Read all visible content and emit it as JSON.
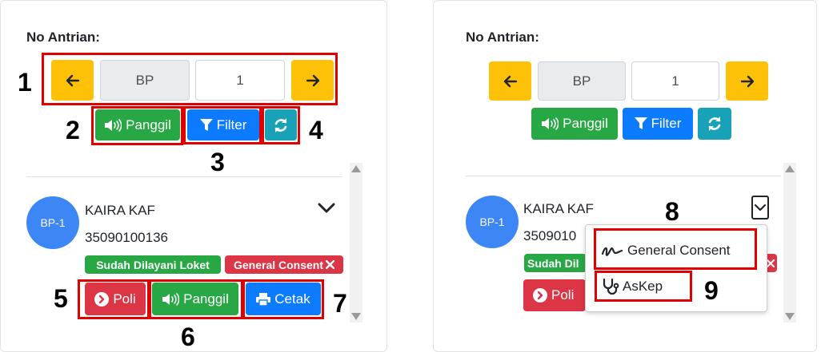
{
  "left": {
    "label": "No Antrian:",
    "prefix_value": "BP",
    "number_value": "1",
    "panggil_label": "Panggil",
    "filter_label": "Filter",
    "patient": {
      "avatar": "BP-1",
      "name": "KAIRA KAF",
      "id": "35090100136",
      "badge_loket": "Sudah Dilayani Loket",
      "badge_consent": "General Consent"
    },
    "poli_label": "Poli",
    "panggil2_label": "Panggil",
    "cetak_label": "Cetak",
    "numbers": [
      "1",
      "2",
      "3",
      "4",
      "5",
      "6",
      "7"
    ]
  },
  "right": {
    "label": "No Antrian:",
    "prefix_value": "BP",
    "number_value": "1",
    "panggil_label": "Panggil",
    "filter_label": "Filter",
    "patient": {
      "avatar": "BP-1",
      "name": "KAIRA KAF",
      "id_partial": "3509010",
      "badge_loket_partial": "Sudah Dil"
    },
    "poli_label": "Poli",
    "menu": {
      "general_consent": "General Consent",
      "askep": "AsKep"
    },
    "numbers": [
      "8",
      "9"
    ]
  },
  "colors": {
    "warning": "#ffc107",
    "success": "#28a745",
    "primary": "#0d7bff",
    "info": "#17a2b8",
    "danger": "#dc3545",
    "avatar": "#3d86f5",
    "annotation": "#e10000"
  }
}
